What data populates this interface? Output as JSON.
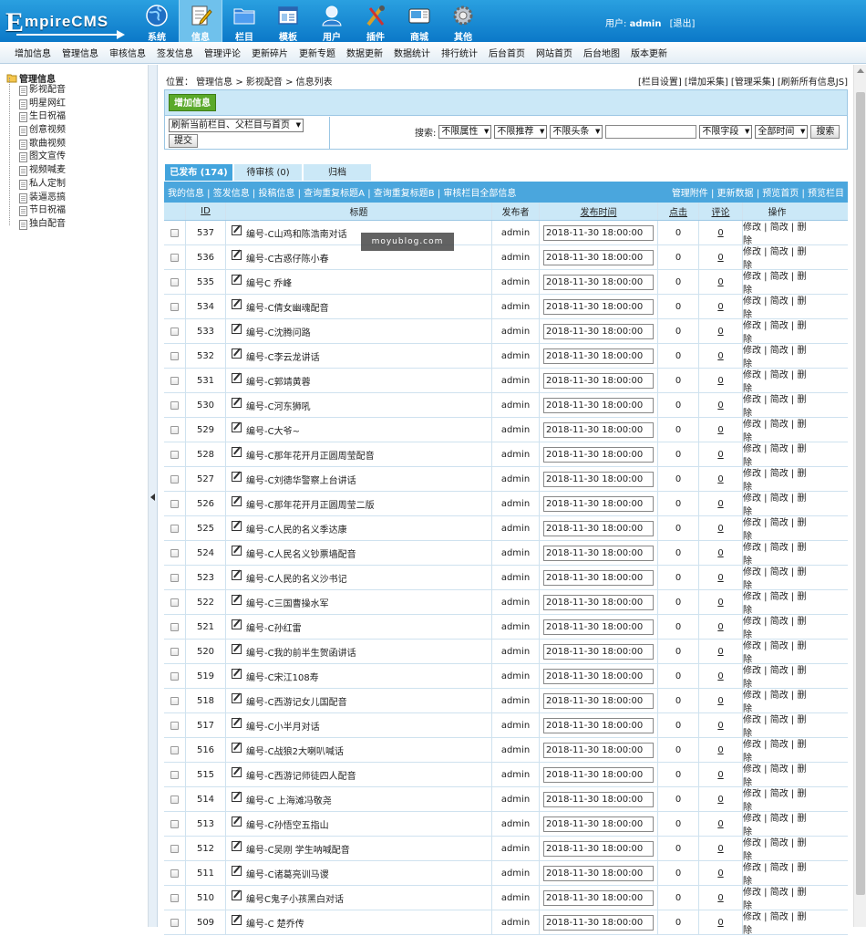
{
  "logo": {
    "big": "E",
    "rest": "mpireCMS"
  },
  "nav": [
    {
      "label": "系统",
      "icon": "globe-icon"
    },
    {
      "label": "信息",
      "icon": "note-icon",
      "active": true
    },
    {
      "label": "栏目",
      "icon": "folder-icon"
    },
    {
      "label": "模板",
      "icon": "template-icon"
    },
    {
      "label": "用户",
      "icon": "user-icon"
    },
    {
      "label": "插件",
      "icon": "tools-icon"
    },
    {
      "label": "商城",
      "icon": "shop-icon"
    },
    {
      "label": "其他",
      "icon": "gear-icon"
    }
  ],
  "user": {
    "label": "用户:",
    "name": "admin",
    "logout": "[退出]"
  },
  "subnav": [
    "增加信息",
    "管理信息",
    "审核信息",
    "签发信息",
    "管理评论",
    "更新碎片",
    "更新专题",
    "数据更新",
    "数据统计",
    "排行统计",
    "后台首页",
    "网站首页",
    "后台地图",
    "版本更新"
  ],
  "tree": {
    "root": "管理信息",
    "items": [
      "影视配音",
      "明星网红",
      "生日祝福",
      "创意视频",
      "歌曲视频",
      "图文宣传",
      "视频喊麦",
      "私人定制",
      "装逼恶搞",
      "节日祝福",
      "独白配音"
    ]
  },
  "location": "位置： 管理信息 > 影视配音 > 信息列表",
  "toplinks": "[栏目设置] [增加采集] [管理采集] [刷新所有信息JS]",
  "add_button": "增加信息",
  "refresh_select": "刷新当前栏目、父栏目与首页",
  "submit": "提交",
  "search": {
    "label": "搜索:",
    "f1": "不限属性",
    "f2": "不限推荐",
    "f3": "不限头条",
    "f4": "不限字段",
    "f5": "全部时间",
    "btn": "搜索"
  },
  "tabs": [
    "已发布 (174)",
    "待审核 (0)",
    "归档"
  ],
  "bar_left": "我的信息 | 签发信息 | 投稿信息 | 查询重复标题A | 查询重复标题B | 审核栏目全部信息",
  "bar_right": "管理附件 | 更新数据 | 预览首页 | 预览栏目",
  "headers": {
    "id": "ID",
    "title": "标题",
    "publisher": "发布者",
    "time": "发布时间",
    "clicks": "点击",
    "comments": "评论",
    "ops": "操作"
  },
  "ops": "修改 | 简改 | 删除",
  "watermark": "moyublog.com",
  "rows": [
    {
      "id": "537",
      "title": "编号-C山鸡和陈浩南对话"
    },
    {
      "id": "536",
      "title": "编号-C古惑仔陈小春"
    },
    {
      "id": "535",
      "title": "编号C 乔峰"
    },
    {
      "id": "534",
      "title": "编号-C倩女幽魂配音"
    },
    {
      "id": "533",
      "title": "编号-C沈腾问路"
    },
    {
      "id": "532",
      "title": "编号-C李云龙讲话"
    },
    {
      "id": "531",
      "title": "编号-C郭靖黄蓉"
    },
    {
      "id": "530",
      "title": "编号-C河东狮吼"
    },
    {
      "id": "529",
      "title": "编号-C大爷~"
    },
    {
      "id": "528",
      "title": "编号-C那年花开月正圆周莹配音"
    },
    {
      "id": "527",
      "title": "编号-C刘德华警察上台讲话"
    },
    {
      "id": "526",
      "title": "编号-C那年花开月正圆周莹二版"
    },
    {
      "id": "525",
      "title": "编号-C人民的名义季达康"
    },
    {
      "id": "524",
      "title": "编号-C人民名义钞票墙配音"
    },
    {
      "id": "523",
      "title": "编号-C人民的名义沙书记"
    },
    {
      "id": "522",
      "title": "编号-C三国曹操水军"
    },
    {
      "id": "521",
      "title": "编号-C孙红雷"
    },
    {
      "id": "520",
      "title": "编号-C我的前半生贺函讲话"
    },
    {
      "id": "519",
      "title": "编号-C宋江108寿"
    },
    {
      "id": "518",
      "title": "编号-C西游记女儿国配音"
    },
    {
      "id": "517",
      "title": "编号-C小半月对话"
    },
    {
      "id": "516",
      "title": "编号-C战狼2大喇叭喊话"
    },
    {
      "id": "515",
      "title": "编号-C西游记师徒四人配音"
    },
    {
      "id": "514",
      "title": "编号-C 上海滩冯敬尧"
    },
    {
      "id": "513",
      "title": "编号-C孙悟空五指山"
    },
    {
      "id": "512",
      "title": "编号-C吴刚 学生呐喊配音"
    },
    {
      "id": "511",
      "title": "编号-C诸葛亮训马谡"
    },
    {
      "id": "510",
      "title": "编号C鬼子小孩黑白对话"
    },
    {
      "id": "509",
      "title": "编号-C 楚乔传"
    }
  ],
  "row_common": {
    "publisher": "admin",
    "time": "2018-11-30 18:00:00",
    "clicks": "0",
    "comments": "0"
  }
}
